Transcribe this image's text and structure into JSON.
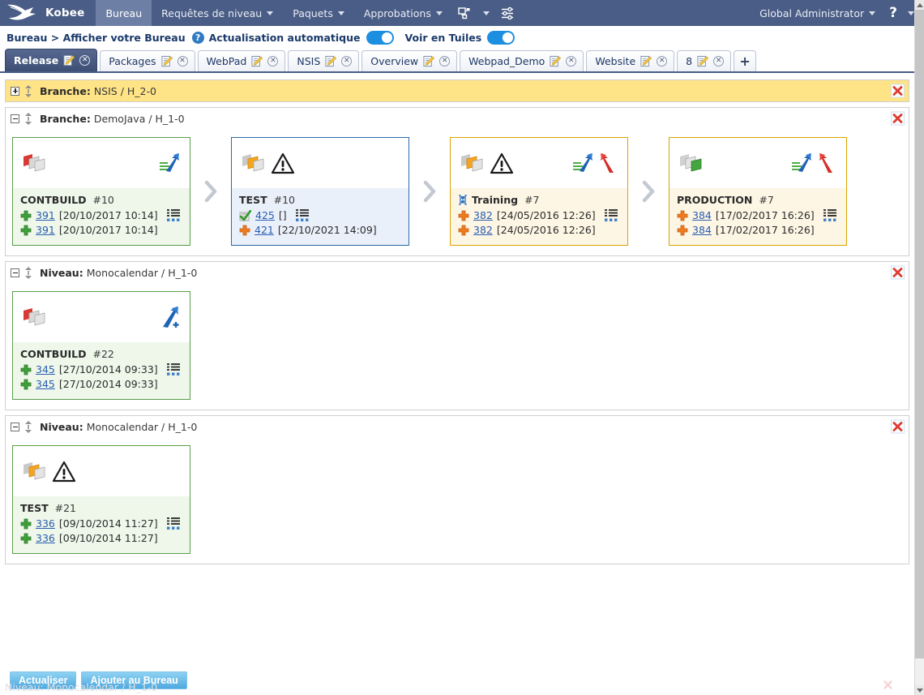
{
  "app": {
    "brand": "Kobee",
    "logo_icon": "bird-logo-icon"
  },
  "topnav": {
    "items": [
      {
        "label": "Bureau",
        "active": true,
        "has_caret": false
      },
      {
        "label": "Requêtes de niveau",
        "active": false,
        "has_caret": true
      },
      {
        "label": "Paquets",
        "active": false,
        "has_caret": true
      },
      {
        "label": "Approbations",
        "active": false,
        "has_caret": true
      }
    ],
    "hierarchy_icon": "sitemap-icon",
    "hierarchy_caret_icon": "chevron-down-icon",
    "settings_icon": "sliders-icon",
    "user_label": "Global Administrator",
    "user_caret_icon": "chevron-down-icon",
    "help_label": "?",
    "help_caret_icon": "chevron-down-icon"
  },
  "breadcrumb": {
    "text": "Bureau > Afficher votre Bureau",
    "help_icon": "question-circle-icon",
    "auto_refresh_label": "Actualisation automatique",
    "auto_refresh_on": true,
    "tiles_view_label": "Voir en Tuiles",
    "tiles_view_on": true
  },
  "tabs": {
    "items": [
      {
        "label": "Release",
        "active": true,
        "edit_icon": "edit-note-icon",
        "close_icon": "close-circle-icon"
      },
      {
        "label": "Packages",
        "active": false,
        "edit_icon": "edit-note-icon",
        "close_icon": "close-circle-icon"
      },
      {
        "label": "WebPad",
        "active": false,
        "edit_icon": "edit-note-icon",
        "close_icon": "close-circle-icon"
      },
      {
        "label": "NSIS",
        "active": false,
        "edit_icon": "edit-note-icon",
        "close_icon": "close-circle-icon"
      },
      {
        "label": "Overview",
        "active": false,
        "edit_icon": "edit-note-icon",
        "close_icon": "close-circle-icon"
      },
      {
        "label": "Webpad_Demo",
        "active": false,
        "edit_icon": "edit-note-icon",
        "close_icon": "close-circle-icon"
      },
      {
        "label": "Website",
        "active": false,
        "edit_icon": "edit-note-icon",
        "close_icon": "close-circle-icon"
      },
      {
        "label": "8",
        "active": false,
        "edit_icon": "edit-note-icon",
        "close_icon": "close-circle-icon"
      }
    ],
    "add_label": "+"
  },
  "panels": [
    {
      "kind_label": "Branche:",
      "title": "NSIS / H_2-0",
      "collapsed": true,
      "header_style": "yellow",
      "close_icon": "red-x-icon",
      "expand_icon": "plus-box-icon",
      "drag_icon": "updown-arrow-icon",
      "tiles": []
    },
    {
      "kind_label": "Branche:",
      "title": "DemoJava / H_1-0",
      "collapsed": false,
      "header_style": "plain",
      "close_icon": "red-x-icon",
      "expand_icon": "minus-box-icon",
      "drag_icon": "updown-arrow-icon",
      "tiles": [
        {
          "name": "CONTBUILD",
          "number": "#10",
          "color": "green",
          "layers_icon": "layers-red-icon",
          "warning_icon": null,
          "prefix_icon": null,
          "arrows": [
            "arrow-up-blue-icon"
          ],
          "rows": [
            {
              "status_icon": "plus-green-icon",
              "link": "391",
              "text": "[20/10/2017 10:14]",
              "has_list_icon": true
            },
            {
              "status_icon": "plus-green-icon",
              "link": "391",
              "text": "[20/10/2017 10:14]",
              "has_list_icon": false
            }
          ]
        },
        {
          "name": "TEST",
          "number": "#10",
          "color": "blue",
          "layers_icon": "layers-orange-icon",
          "warning_icon": "warning-triangle-icon",
          "prefix_icon": null,
          "arrows": [],
          "rows": [
            {
              "status_icon": "check-green-icon",
              "link": "425",
              "text": "[]",
              "has_list_icon": true
            },
            {
              "status_icon": "plus-orange-icon",
              "link": "421",
              "text": "[22/10/2021 14:09]",
              "has_list_icon": false
            }
          ]
        },
        {
          "name": "Training",
          "number": "#7",
          "color": "yellow",
          "layers_icon": "layers-orange-icon",
          "warning_icon": "warning-triangle-icon",
          "prefix_icon": "server-blue-icon",
          "arrows": [
            "arrow-up-blue-icon",
            "arrow-down-red-icon"
          ],
          "rows": [
            {
              "status_icon": "plus-orange-icon",
              "link": "382",
              "text": "[24/05/2016 12:26]",
              "has_list_icon": true
            },
            {
              "status_icon": "plus-orange-icon",
              "link": "382",
              "text": "[24/05/2016 12:26]",
              "has_list_icon": false
            }
          ]
        },
        {
          "name": "PRODUCTION",
          "number": "#7",
          "color": "yellow",
          "layers_icon": "layers-green-icon",
          "warning_icon": null,
          "prefix_icon": null,
          "arrows": [
            "arrow-up-blue-icon",
            "arrow-down-red-icon"
          ],
          "rows": [
            {
              "status_icon": "plus-orange-icon",
              "link": "384",
              "text": "[17/02/2017 16:26]",
              "has_list_icon": true
            },
            {
              "status_icon": "plus-orange-icon",
              "link": "384",
              "text": "[17/02/2017 16:26]",
              "has_list_icon": false
            }
          ]
        }
      ]
    },
    {
      "kind_label": "Niveau:",
      "title": "Monocalendar / H_1-0",
      "collapsed": false,
      "header_style": "plain",
      "close_icon": "red-x-icon",
      "expand_icon": "minus-box-icon",
      "drag_icon": "updown-arrow-icon",
      "tiles": [
        {
          "name": "CONTBUILD",
          "number": "#22",
          "color": "green",
          "layers_icon": "layers-red-icon",
          "warning_icon": null,
          "prefix_icon": null,
          "arrows": [
            "arrow-up-blue-plus-icon"
          ],
          "rows": [
            {
              "status_icon": "plus-green-icon",
              "link": "345",
              "text": "[27/10/2014 09:33]",
              "has_list_icon": true
            },
            {
              "status_icon": "plus-green-icon",
              "link": "345",
              "text": "[27/10/2014 09:33]",
              "has_list_icon": false
            }
          ]
        }
      ]
    },
    {
      "kind_label": "Niveau:",
      "title": "Monocalendar / H_1-0",
      "collapsed": false,
      "header_style": "plain",
      "close_icon": "red-x-icon",
      "expand_icon": "minus-box-icon",
      "drag_icon": "updown-arrow-icon",
      "tiles": [
        {
          "name": "TEST",
          "number": "#21",
          "color": "green",
          "layers_icon": "layers-orange-icon",
          "warning_icon": "warning-triangle-icon",
          "prefix_icon": null,
          "arrows": [],
          "rows": [
            {
              "status_icon": "plus-green-icon",
              "link": "336",
              "text": "[09/10/2014 11:27]",
              "has_list_icon": true
            },
            {
              "status_icon": "plus-green-icon",
              "link": "336",
              "text": "[09/10/2014 11:27]",
              "has_list_icon": false
            }
          ]
        }
      ]
    }
  ],
  "footer": {
    "refresh_label": "Actualiser",
    "add_label": "Ajouter au Bureau",
    "ghost_row_text": "Niveau: Monocalendar / H_1-0"
  },
  "scrollbar": {
    "up_icon": "scroll-up-arrow-icon",
    "down_icon": "scroll-down-arrow-icon"
  },
  "colors": {
    "nav_bg": "#4a5d86",
    "nav_active": "#6d7fa4",
    "accent_blue": "#1d8fe0",
    "link": "#2a5db0",
    "panel_yellow": "#ffe487",
    "tile_green_border": "#5a9e4b",
    "tile_blue_border": "#2c6aa8",
    "tile_yellow_border": "#dba400"
  }
}
